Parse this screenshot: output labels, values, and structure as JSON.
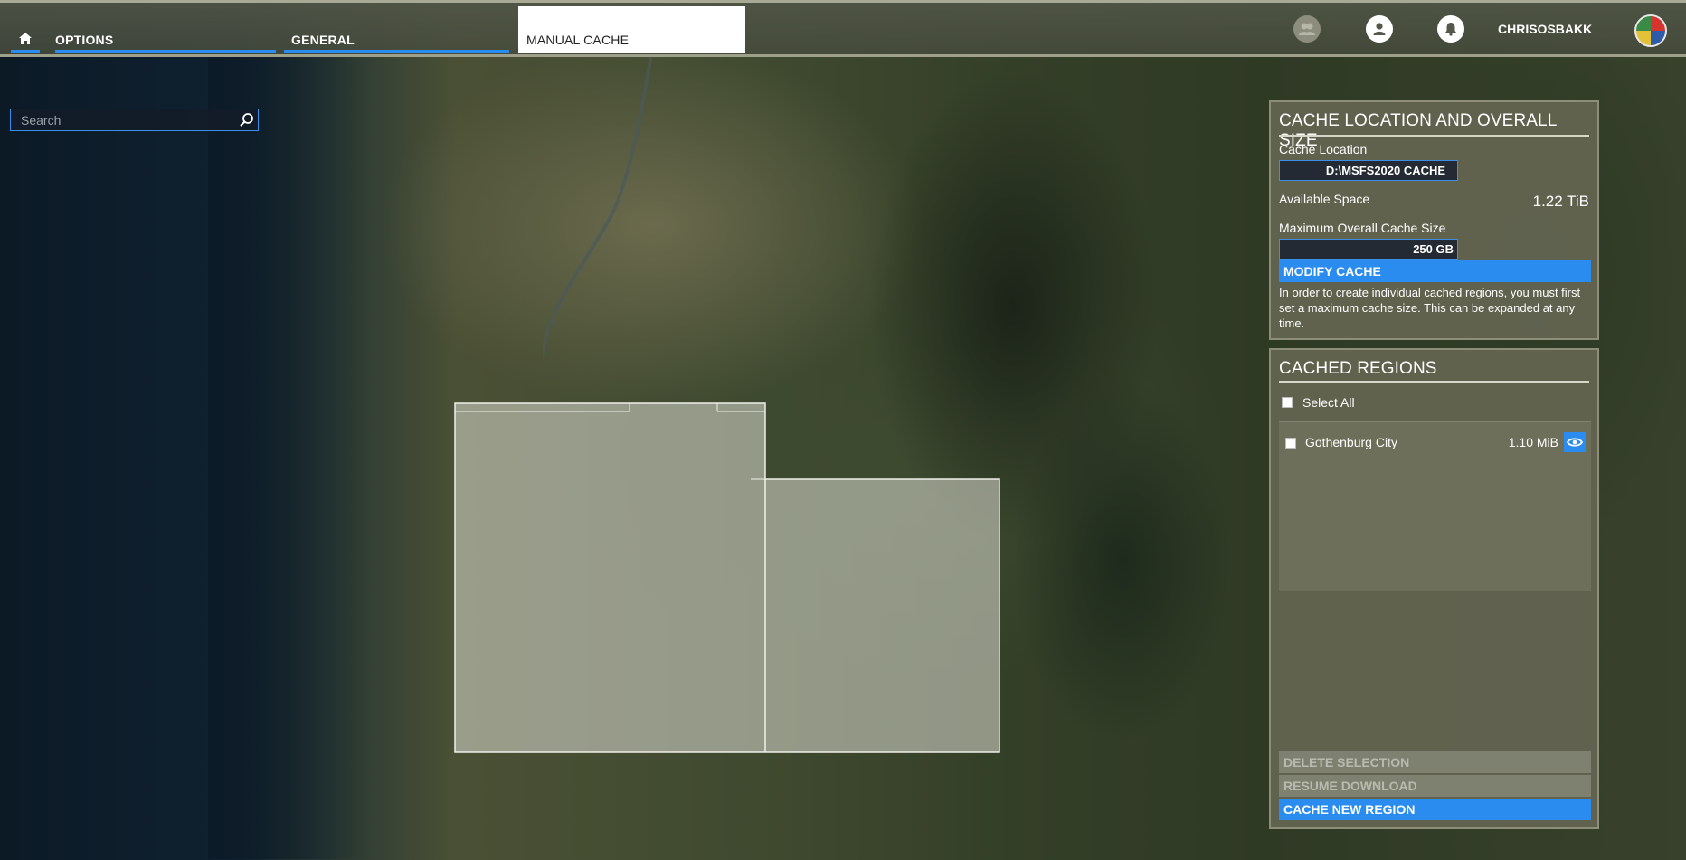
{
  "topbar": {
    "tabs": [
      {
        "label": "OPTIONS"
      },
      {
        "label": "GENERAL"
      },
      {
        "label": "MANUAL CACHE"
      }
    ],
    "username": "CHRISOSBAKK",
    "icons": [
      "home-icon",
      "friends-icon",
      "profile-icon",
      "notifications-icon"
    ]
  },
  "search": {
    "placeholder": "Search"
  },
  "cache_panel": {
    "title": "CACHE LOCATION AND OVERALL SIZE",
    "location_label": "Cache Location",
    "location_value": "D:\\MSFS2020 CACHE",
    "available_label": "Available Space",
    "available_value": "1.22 TiB",
    "max_size_label": "Maximum Overall Cache Size",
    "max_size_value": "250 GB",
    "modify_button": "MODIFY CACHE",
    "help_text": "In order to create individual cached regions, you must first set a maximum cache size. This can be expanded at any time."
  },
  "regions_panel": {
    "title": "CACHED REGIONS",
    "select_all_label": "Select All",
    "regions": [
      {
        "name": "Gothenburg City",
        "size": "1.10 MiB"
      }
    ],
    "delete_button": "DELETE SELECTION",
    "resume_button": "RESUME DOWNLOAD",
    "cache_new_button": "CACHE NEW REGION"
  },
  "colors": {
    "accent": "#2b8cf0",
    "panel_bg": "#66685a",
    "topbar_bg": "#50554a"
  }
}
